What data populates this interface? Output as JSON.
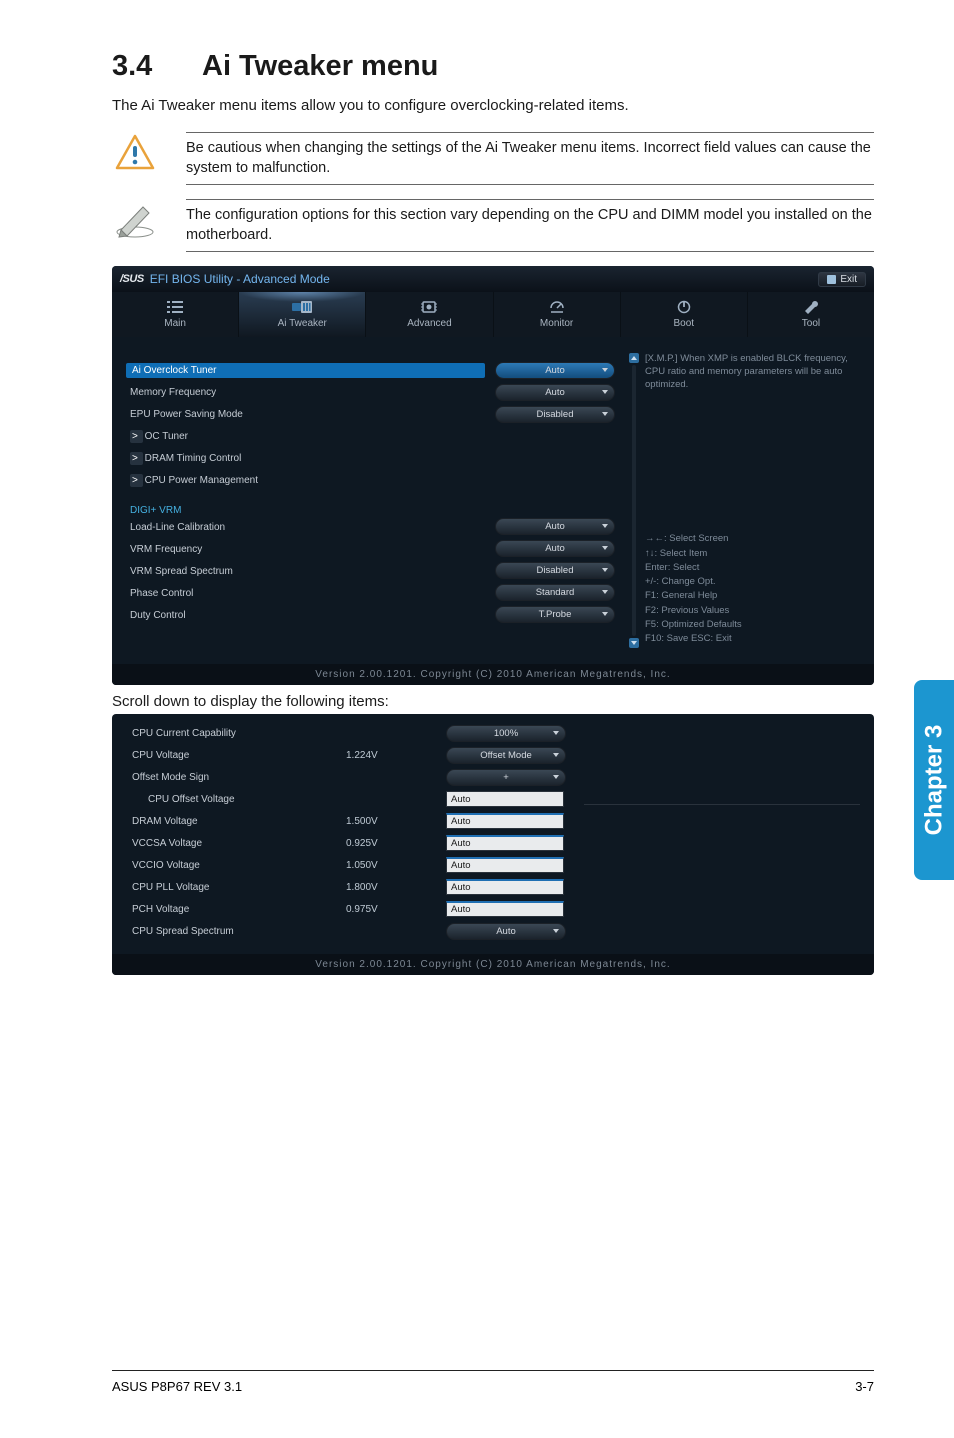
{
  "heading_num": "3.4",
  "heading_title": "Ai Tweaker menu",
  "intro": "The Ai Tweaker menu items allow you to configure overclocking-related items.",
  "note1": "Be cautious when changing the settings of the Ai Tweaker menu items. Incorrect field values can cause the system to malfunction.",
  "note2": "The configuration options for this section vary depending on the CPU and DIMM model you installed on the motherboard.",
  "bios": {
    "brand": "/SUS",
    "title": "EFI BIOS Utility - Advanced Mode",
    "exit": "Exit",
    "tabs": {
      "main": "Main",
      "ai": "Ai Tweaker",
      "adv": "Advanced",
      "mon": "Monitor",
      "boot": "Boot",
      "tool": "Tool"
    },
    "rows": {
      "ai_overclock": "Ai Overclock Tuner",
      "mem_freq": "Memory Frequency",
      "epu": "EPU Power Saving Mode",
      "oc_tuner": "OC Tuner",
      "dram": "DRAM Timing Control",
      "cpu_pm": "CPU Power Management",
      "section": "DIGI+ VRM",
      "llc": "Load-Line Calibration",
      "vrmf": "VRM Frequency",
      "vrmss": "VRM Spread Spectrum",
      "phase": "Phase Control",
      "duty": "Duty Control"
    },
    "vals": {
      "ai_overclock": "Auto",
      "mem_freq": "Auto",
      "epu": "Disabled",
      "llc": "Auto",
      "vrmf": "Auto",
      "vrmss": "Disabled",
      "phase": "Standard",
      "duty": "T.Probe"
    },
    "help": "[X.M.P.] When XMP is enabled BLCK frequency, CPU ratio and memory parameters will be auto optimized.",
    "hints": {
      "l1": "→←: Select Screen",
      "l2": "↑↓: Select Item",
      "l3": "Enter: Select",
      "l4": "+/-: Change Opt.",
      "l5": "F1: General Help",
      "l6": "F2: Previous Values",
      "l7": "F5: Optimized Defaults",
      "l8": "F10: Save   ESC: Exit"
    },
    "footer": "Version 2.00.1201.  Copyright (C) 2010 American Megatrends, Inc."
  },
  "scroll_caption": "Scroll down to display the following items:",
  "panel2": {
    "rows": {
      "ccc": {
        "label": "CPU Current Capability",
        "value": "",
        "field": "100%"
      },
      "cpuv": {
        "label": "CPU Voltage",
        "value": "1.224V",
        "field": "Offset Mode"
      },
      "oms": {
        "label": "Offset Mode Sign",
        "value": "",
        "field": "+"
      },
      "cov": {
        "label": "CPU Offset Voltage",
        "value": "",
        "field": "Auto"
      },
      "dram": {
        "label": "DRAM Voltage",
        "value": "1.500V",
        "field": "Auto"
      },
      "vccsa": {
        "label": "VCCSA Voltage",
        "value": "0.925V",
        "field": "Auto"
      },
      "vccio": {
        "label": "VCCIO Voltage",
        "value": "1.050V",
        "field": "Auto"
      },
      "pll": {
        "label": "CPU PLL Voltage",
        "value": "1.800V",
        "field": "Auto"
      },
      "pch": {
        "label": "PCH Voltage",
        "value": "0.975V",
        "field": "Auto"
      },
      "css": {
        "label": "CPU Spread Spectrum",
        "value": "",
        "field": "Auto"
      }
    },
    "footer": "Version 2.00.1201.  Copyright (C) 2010 American Megatrends, Inc."
  },
  "sidebar": "Chapter 3",
  "footer_left": "ASUS P8P67 REV 3.1",
  "footer_right": "3-7"
}
